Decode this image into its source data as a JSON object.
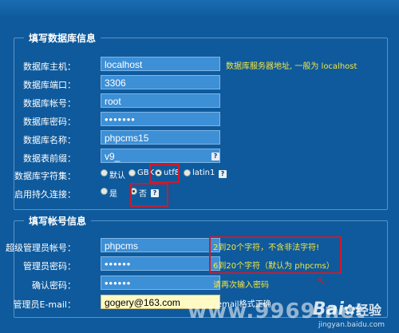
{
  "db_section": {
    "title": "填写数据库信息",
    "fields": [
      {
        "label": "数据库主机：",
        "value": "localhost",
        "hint": "数据库服务器地址, 一般为 localhost"
      },
      {
        "label": "数据库端口：",
        "value": "3306"
      },
      {
        "label": "数据库帐号：",
        "value": "root"
      },
      {
        "label": "数据库密码：",
        "value": "•••••••"
      },
      {
        "label": "数据库名称：",
        "value": "phpcms15"
      },
      {
        "label": "数据表前缀：",
        "value": "v9_"
      }
    ],
    "charset": {
      "label": "数据库字符集：",
      "options": [
        "默认",
        "GBK",
        "utf8",
        "latin1"
      ],
      "selected": "utf8"
    },
    "persistent": {
      "label": "启用持久连接：",
      "options": [
        "是",
        "否"
      ],
      "selected": "否"
    },
    "help_glyph": "?"
  },
  "account_section": {
    "title": "填写帐号信息",
    "fields": [
      {
        "label": "超级管理员帐号：",
        "value": "phpcms",
        "hint": "2到20个字符，不含非法字符!"
      },
      {
        "label": "管理员密码：",
        "value": "••••••",
        "hint": "6到20个字符（默认为 phpcms）"
      },
      {
        "label": "确认密码：",
        "value": "••••••",
        "hint": "请再次输入密码"
      },
      {
        "label": "管理员E-mail：",
        "value": "gogery@163.com",
        "hint": "email格式正确"
      }
    ]
  },
  "watermarks": {
    "center": "www.9969.net",
    "brand": "Bai",
    "brand2": "经验",
    "url": "jingyan.baidu.com"
  },
  "colors": {
    "background": "#0e5a9c",
    "input": "#3d8fd6",
    "hint": "#f5e642",
    "annotation": "#d0192b"
  }
}
